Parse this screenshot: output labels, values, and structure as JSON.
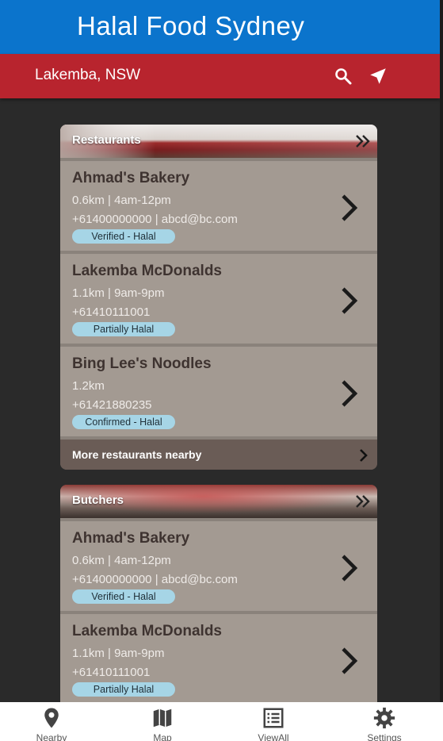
{
  "app": {
    "title": "Halal Food Sydney"
  },
  "location_bar": {
    "location": "Lakemba, NSW",
    "search_icon": "search-icon",
    "nav_icon": "navigation-arrow-icon"
  },
  "colors": {
    "app_bar": "#0b74cc",
    "location_bar": "#b8242e",
    "card_item": "#a39a92",
    "badge": "#a6d5e6",
    "background": "#2a2a2a"
  },
  "restaurants": {
    "title": "Restaurants",
    "items": [
      {
        "name": "Ahmad's Bakery",
        "line1": "0.6km | 4am-12pm",
        "line2": "+61400000000 | abcd@bc.com",
        "badge": "Verified - Halal"
      },
      {
        "name": "Lakemba McDonalds",
        "line1": "1.1km | 9am-9pm",
        "line2": "+61410111001",
        "badge": "Partially Halal"
      },
      {
        "name": "Bing Lee's Noodles",
        "line1": "1.2km",
        "line2": "+61421880235",
        "badge": "Confirmed - Halal"
      }
    ],
    "more_label": "More restaurants nearby"
  },
  "butchers": {
    "title": "Butchers",
    "items": [
      {
        "name": "Ahmad's Bakery",
        "line1": "0.6km | 4am-12pm",
        "line2": "+61400000000 | abcd@bc.com",
        "badge": "Verified - Halal"
      },
      {
        "name": "Lakemba McDonalds",
        "line1": "1.1km | 9am-9pm",
        "line2": "+61410111001",
        "badge": "Partially Halal"
      }
    ]
  },
  "bottom_nav": {
    "items": [
      {
        "label": "Nearby",
        "icon": "map-pin-icon"
      },
      {
        "label": "Map",
        "icon": "map-icon"
      },
      {
        "label": "ViewAll",
        "icon": "list-icon"
      },
      {
        "label": "Settings",
        "icon": "gear-icon"
      }
    ]
  }
}
